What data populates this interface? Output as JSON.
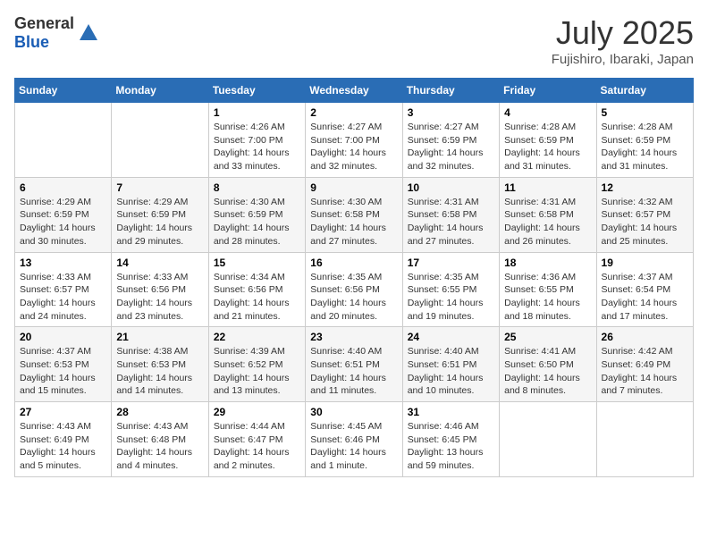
{
  "header": {
    "logo": {
      "general": "General",
      "blue": "Blue"
    },
    "title": "July 2025",
    "subtitle": "Fujishiro, Ibaraki, Japan"
  },
  "days_of_week": [
    "Sunday",
    "Monday",
    "Tuesday",
    "Wednesday",
    "Thursday",
    "Friday",
    "Saturday"
  ],
  "weeks": [
    [
      {
        "day": "",
        "info": ""
      },
      {
        "day": "",
        "info": ""
      },
      {
        "day": "1",
        "info": "Sunrise: 4:26 AM\nSunset: 7:00 PM\nDaylight: 14 hours and 33 minutes."
      },
      {
        "day": "2",
        "info": "Sunrise: 4:27 AM\nSunset: 7:00 PM\nDaylight: 14 hours and 32 minutes."
      },
      {
        "day": "3",
        "info": "Sunrise: 4:27 AM\nSunset: 6:59 PM\nDaylight: 14 hours and 32 minutes."
      },
      {
        "day": "4",
        "info": "Sunrise: 4:28 AM\nSunset: 6:59 PM\nDaylight: 14 hours and 31 minutes."
      },
      {
        "day": "5",
        "info": "Sunrise: 4:28 AM\nSunset: 6:59 PM\nDaylight: 14 hours and 31 minutes."
      }
    ],
    [
      {
        "day": "6",
        "info": "Sunrise: 4:29 AM\nSunset: 6:59 PM\nDaylight: 14 hours and 30 minutes."
      },
      {
        "day": "7",
        "info": "Sunrise: 4:29 AM\nSunset: 6:59 PM\nDaylight: 14 hours and 29 minutes."
      },
      {
        "day": "8",
        "info": "Sunrise: 4:30 AM\nSunset: 6:59 PM\nDaylight: 14 hours and 28 minutes."
      },
      {
        "day": "9",
        "info": "Sunrise: 4:30 AM\nSunset: 6:58 PM\nDaylight: 14 hours and 27 minutes."
      },
      {
        "day": "10",
        "info": "Sunrise: 4:31 AM\nSunset: 6:58 PM\nDaylight: 14 hours and 27 minutes."
      },
      {
        "day": "11",
        "info": "Sunrise: 4:31 AM\nSunset: 6:58 PM\nDaylight: 14 hours and 26 minutes."
      },
      {
        "day": "12",
        "info": "Sunrise: 4:32 AM\nSunset: 6:57 PM\nDaylight: 14 hours and 25 minutes."
      }
    ],
    [
      {
        "day": "13",
        "info": "Sunrise: 4:33 AM\nSunset: 6:57 PM\nDaylight: 14 hours and 24 minutes."
      },
      {
        "day": "14",
        "info": "Sunrise: 4:33 AM\nSunset: 6:56 PM\nDaylight: 14 hours and 23 minutes."
      },
      {
        "day": "15",
        "info": "Sunrise: 4:34 AM\nSunset: 6:56 PM\nDaylight: 14 hours and 21 minutes."
      },
      {
        "day": "16",
        "info": "Sunrise: 4:35 AM\nSunset: 6:56 PM\nDaylight: 14 hours and 20 minutes."
      },
      {
        "day": "17",
        "info": "Sunrise: 4:35 AM\nSunset: 6:55 PM\nDaylight: 14 hours and 19 minutes."
      },
      {
        "day": "18",
        "info": "Sunrise: 4:36 AM\nSunset: 6:55 PM\nDaylight: 14 hours and 18 minutes."
      },
      {
        "day": "19",
        "info": "Sunrise: 4:37 AM\nSunset: 6:54 PM\nDaylight: 14 hours and 17 minutes."
      }
    ],
    [
      {
        "day": "20",
        "info": "Sunrise: 4:37 AM\nSunset: 6:53 PM\nDaylight: 14 hours and 15 minutes."
      },
      {
        "day": "21",
        "info": "Sunrise: 4:38 AM\nSunset: 6:53 PM\nDaylight: 14 hours and 14 minutes."
      },
      {
        "day": "22",
        "info": "Sunrise: 4:39 AM\nSunset: 6:52 PM\nDaylight: 14 hours and 13 minutes."
      },
      {
        "day": "23",
        "info": "Sunrise: 4:40 AM\nSunset: 6:51 PM\nDaylight: 14 hours and 11 minutes."
      },
      {
        "day": "24",
        "info": "Sunrise: 4:40 AM\nSunset: 6:51 PM\nDaylight: 14 hours and 10 minutes."
      },
      {
        "day": "25",
        "info": "Sunrise: 4:41 AM\nSunset: 6:50 PM\nDaylight: 14 hours and 8 minutes."
      },
      {
        "day": "26",
        "info": "Sunrise: 4:42 AM\nSunset: 6:49 PM\nDaylight: 14 hours and 7 minutes."
      }
    ],
    [
      {
        "day": "27",
        "info": "Sunrise: 4:43 AM\nSunset: 6:49 PM\nDaylight: 14 hours and 5 minutes."
      },
      {
        "day": "28",
        "info": "Sunrise: 4:43 AM\nSunset: 6:48 PM\nDaylight: 14 hours and 4 minutes."
      },
      {
        "day": "29",
        "info": "Sunrise: 4:44 AM\nSunset: 6:47 PM\nDaylight: 14 hours and 2 minutes."
      },
      {
        "day": "30",
        "info": "Sunrise: 4:45 AM\nSunset: 6:46 PM\nDaylight: 14 hours and 1 minute."
      },
      {
        "day": "31",
        "info": "Sunrise: 4:46 AM\nSunset: 6:45 PM\nDaylight: 13 hours and 59 minutes."
      },
      {
        "day": "",
        "info": ""
      },
      {
        "day": "",
        "info": ""
      }
    ]
  ]
}
